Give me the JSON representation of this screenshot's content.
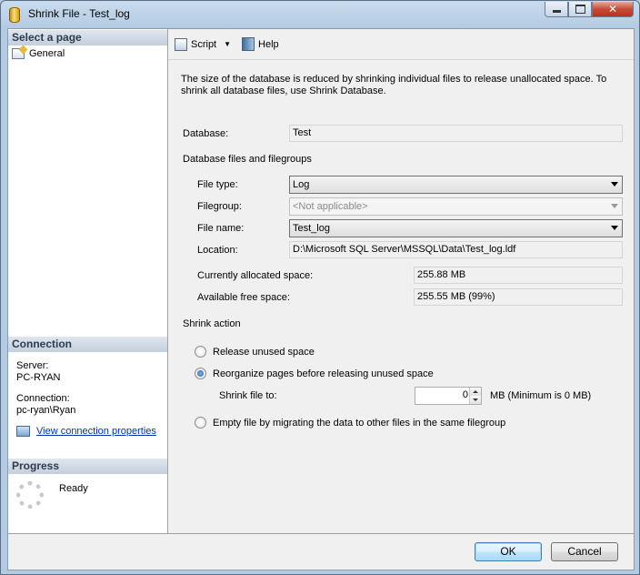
{
  "window": {
    "title": "Shrink File - Test_log",
    "controls": {
      "minimize": "minimize",
      "maximize": "maximize",
      "close": "✕"
    }
  },
  "sidebar": {
    "select_page_header": "Select a page",
    "pages": [
      {
        "label": "General",
        "icon": "page-icon"
      }
    ],
    "connection": {
      "header": "Connection",
      "server_label": "Server:",
      "server_value": "PC-RYAN",
      "connection_label": "Connection:",
      "connection_value": "pc-ryan\\Ryan",
      "view_properties_link": "View connection properties"
    },
    "progress": {
      "header": "Progress",
      "status": "Ready"
    }
  },
  "toolbar": {
    "script_label": "Script",
    "help_label": "Help"
  },
  "main": {
    "description": "The size of the database is reduced by shrinking individual files to release unallocated space. To shrink all database files, use Shrink Database.",
    "database_label": "Database:",
    "database_value": "Test",
    "files_section": "Database files and filegroups",
    "file_type_label": "File type:",
    "file_type_value": "Log",
    "filegroup_label": "Filegroup:",
    "filegroup_value": "<Not applicable>",
    "file_name_label": "File name:",
    "file_name_value": "Test_log",
    "location_label": "Location:",
    "location_value": "D:\\Microsoft SQL Server\\MSSQL\\Data\\Test_log.ldf",
    "allocated_label": "Currently allocated space:",
    "allocated_value": "255.88 MB",
    "free_label": "Available free space:",
    "free_value": "255.55 MB (99%)",
    "shrink_action": "Shrink action",
    "options": [
      {
        "label": "Release unused space",
        "checked": false
      },
      {
        "label": "Reorganize pages before releasing unused space",
        "checked": true
      },
      {
        "label": "Empty file by migrating the data to other files in the same filegroup",
        "checked": false
      }
    ],
    "shrink_to_label": "Shrink file to:",
    "shrink_to_value": "0",
    "shrink_to_unit": "MB (Minimum is 0 MB)"
  },
  "footer": {
    "ok_label": "OK",
    "cancel_label": "Cancel"
  }
}
